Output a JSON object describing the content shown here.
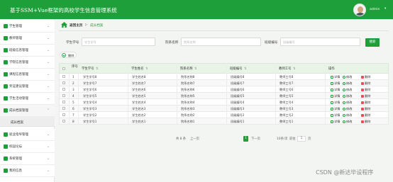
{
  "header": {
    "title": "基于SSM+Vue框架的高校学生信息管理系统",
    "username": "admin",
    "user_caret": "▾"
  },
  "colors": {
    "accent": "#1f9f3a",
    "danger": "#e45050",
    "header_bg": "#1f9f3a",
    "table_head_bg": "#e8f4e6"
  },
  "sidebar": {
    "items": [
      {
        "label": "学生管理",
        "icon": "user-icon"
      },
      {
        "label": "教师管理",
        "icon": "teacher-icon"
      },
      {
        "label": "班级信息管理",
        "icon": "class-icon"
      },
      {
        "label": "学院信息管理",
        "icon": "college-icon"
      },
      {
        "label": "课程信息管理",
        "icon": "flag-icon"
      },
      {
        "label": "奖证建设管理",
        "icon": "award-icon"
      },
      {
        "label": "学生活动管理",
        "icon": "activity-icon"
      },
      {
        "label": "成长档案管理",
        "icon": "archive-icon",
        "expanded": true
      },
      {
        "label": "就业指导管理",
        "icon": "career-icon"
      },
      {
        "label": "校园论坛",
        "icon": "forum-icon"
      },
      {
        "label": "系统管理",
        "icon": "settings-icon"
      },
      {
        "label": "我的信息",
        "icon": "profile-icon"
      }
    ],
    "sub_item": "成长档案"
  },
  "breadcrumb": {
    "home": "返回主页",
    "separator": "▷",
    "current": "成长档案"
  },
  "search": {
    "fields": [
      {
        "label": "学生学号",
        "placeholder": "学生学号"
      },
      {
        "label": "院系名称",
        "placeholder": "院系名称"
      },
      {
        "label": "班级编号",
        "placeholder": "班级编号"
      }
    ],
    "button": "搜索"
  },
  "toolbar": {
    "delete_label": "删除"
  },
  "table": {
    "headers": [
      "序号",
      "学生学号",
      "学生姓名",
      "院系名称",
      "班级编号",
      "教师工号",
      "操作"
    ],
    "sort_icon": "⇅",
    "rows": [
      [
        "1",
        "学生学号8",
        "学生姓名8",
        "院系名称8",
        "班级编号8",
        "教师工号8"
      ],
      [
        "2",
        "学生学号7",
        "学生姓名7",
        "院系名称7",
        "班级编号7",
        "教师工号7"
      ],
      [
        "3",
        "学生学号6",
        "学生姓名6",
        "院系名称6",
        "班级编号6",
        "教师工号6"
      ],
      [
        "4",
        "学生学号5",
        "学生姓名5",
        "院系名称5",
        "班级编号5",
        "教师工号5"
      ],
      [
        "5",
        "学生学号4",
        "学生姓名4",
        "院系名称4",
        "班级编号4",
        "教师工号4"
      ],
      [
        "6",
        "学生学号3",
        "学生姓名3",
        "院系名称3",
        "班级编号3",
        "教师工号3"
      ],
      [
        "7",
        "学生学号2",
        "学生姓名2",
        "院系名称2",
        "班级编号2",
        "教师工号2"
      ],
      [
        "8",
        "学生学号1",
        "学生姓名1",
        "院系名称1",
        "班级编号1",
        "教师工号1"
      ]
    ],
    "actions": {
      "view": "详情",
      "edit": "修改",
      "delete": "删除"
    }
  },
  "pagination": {
    "total": "共 8 条",
    "prev": "上一页",
    "current_page": "1",
    "next": "下一页",
    "page_size": "10条/页",
    "goto_label": "前往",
    "goto_value": "1",
    "page_suffix": "页"
  },
  "watermark": "CSDN @新达毕设程序"
}
